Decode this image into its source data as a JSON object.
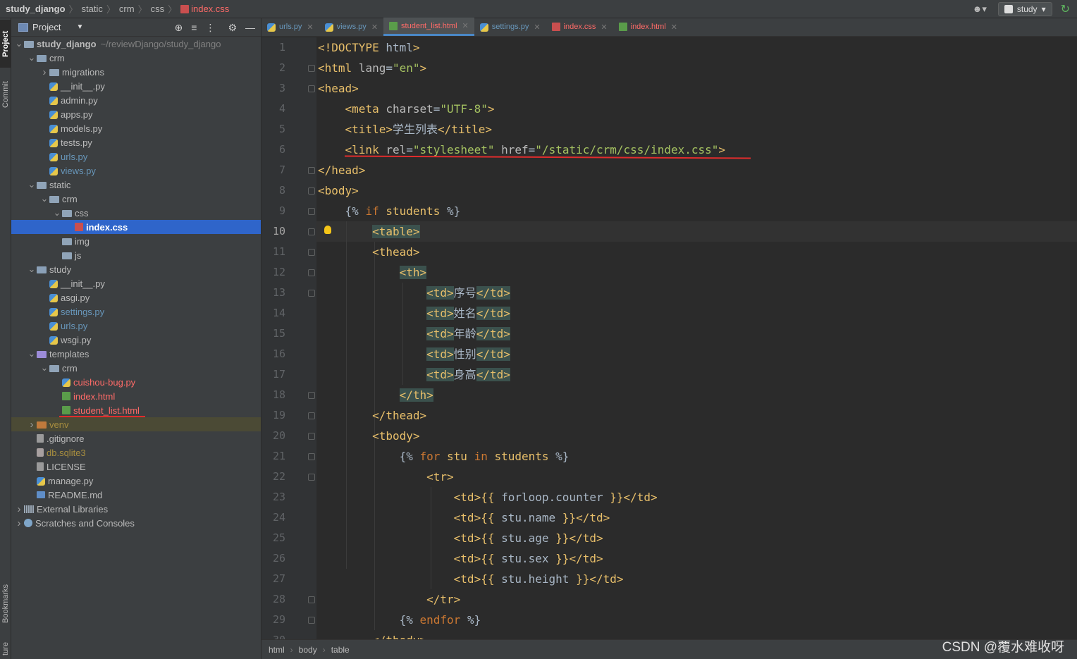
{
  "breadcrumb": {
    "items": [
      "study_django",
      "static",
      "crm",
      "css",
      "index.css"
    ]
  },
  "run_config": {
    "label": "study"
  },
  "left_strip": {
    "project": "Project",
    "commit": "Commit",
    "bookmarks": "Bookmarks",
    "structure": "ture"
  },
  "project_panel": {
    "title": "Project",
    "tree": [
      {
        "label": "study_django",
        "hint": "~/reviewDjango/study_django",
        "depth": 0,
        "type": "folder",
        "open": true,
        "bold": true
      },
      {
        "label": "crm",
        "depth": 1,
        "type": "folder-mod",
        "open": true
      },
      {
        "label": "migrations",
        "depth": 2,
        "type": "folder",
        "collapsed": true
      },
      {
        "label": "__init__.py",
        "depth": 2,
        "type": "py"
      },
      {
        "label": "admin.py",
        "depth": 2,
        "type": "py"
      },
      {
        "label": "apps.py",
        "depth": 2,
        "type": "py"
      },
      {
        "label": "models.py",
        "depth": 2,
        "type": "py"
      },
      {
        "label": "tests.py",
        "depth": 2,
        "type": "py"
      },
      {
        "label": "urls.py",
        "depth": 2,
        "type": "py",
        "color": "blue"
      },
      {
        "label": "views.py",
        "depth": 2,
        "type": "py",
        "color": "blue"
      },
      {
        "label": "static",
        "depth": 1,
        "type": "folder",
        "open": true
      },
      {
        "label": "crm",
        "depth": 2,
        "type": "folder",
        "open": true
      },
      {
        "label": "css",
        "depth": 3,
        "type": "folder",
        "open": true
      },
      {
        "label": "index.css",
        "depth": 4,
        "type": "css",
        "selected": true
      },
      {
        "label": "img",
        "depth": 3,
        "type": "folder"
      },
      {
        "label": "js",
        "depth": 3,
        "type": "folder"
      },
      {
        "label": "study",
        "depth": 1,
        "type": "folder-mod",
        "open": true
      },
      {
        "label": "__init__.py",
        "depth": 2,
        "type": "py"
      },
      {
        "label": "asgi.py",
        "depth": 2,
        "type": "py"
      },
      {
        "label": "settings.py",
        "depth": 2,
        "type": "py",
        "color": "blue"
      },
      {
        "label": "urls.py",
        "depth": 2,
        "type": "py",
        "color": "blue"
      },
      {
        "label": "wsgi.py",
        "depth": 2,
        "type": "py"
      },
      {
        "label": "templates",
        "depth": 1,
        "type": "folder-tpl",
        "open": true
      },
      {
        "label": "crm",
        "depth": 2,
        "type": "folder",
        "open": true
      },
      {
        "label": "cuishou-bug.py",
        "depth": 3,
        "type": "py",
        "color": "red"
      },
      {
        "label": "index.html",
        "depth": 3,
        "type": "html",
        "color": "red"
      },
      {
        "label": "student_list.html",
        "depth": 3,
        "type": "html",
        "color": "red",
        "underline": true
      },
      {
        "label": "venv",
        "depth": 1,
        "type": "folder-ex",
        "collapsed": true,
        "color": "olive",
        "venv": true
      },
      {
        "label": ".gitignore",
        "depth": 1,
        "type": "txt"
      },
      {
        "label": "db.sqlite3",
        "depth": 1,
        "type": "db",
        "color": "olive"
      },
      {
        "label": "LICENSE",
        "depth": 1,
        "type": "txt"
      },
      {
        "label": "manage.py",
        "depth": 1,
        "type": "py"
      },
      {
        "label": "README.md",
        "depth": 1,
        "type": "md"
      },
      {
        "label": "External Libraries",
        "depth": 0,
        "type": "lib",
        "collapsed": true
      },
      {
        "label": "Scratches and Consoles",
        "depth": 0,
        "type": "scratch",
        "collapsed": true
      }
    ]
  },
  "tabs": [
    {
      "label": "urls.py",
      "type": "py"
    },
    {
      "label": "views.py",
      "type": "py"
    },
    {
      "label": "student_list.html",
      "type": "html",
      "active": true
    },
    {
      "label": "settings.py",
      "type": "py"
    },
    {
      "label": "index.css",
      "type": "css"
    },
    {
      "label": "index.html",
      "type": "html"
    }
  ],
  "editor": {
    "current_line": 10,
    "lines": [
      "<!DOCTYPE html>",
      "<html lang=\"en\">",
      "<head>",
      "    <meta charset=\"UTF-8\">",
      "    <title>学生列表</title>",
      "    <link rel=\"stylesheet\" href=\"/static/crm/css/index.css\">",
      "</head>",
      "<body>",
      "    {% if students %}",
      "        <table>",
      "        <thead>",
      "            <th>",
      "                <td>序号</td>",
      "                <td>姓名</td>",
      "                <td>年龄</td>",
      "                <td>性别</td>",
      "                <td>身高</td>",
      "            </th>",
      "        </thead>",
      "        <tbody>",
      "            {% for stu in students %}",
      "                <tr>",
      "                    <td>{{ forloop.counter }}</td>",
      "                    <td>{{ stu.name }}</td>",
      "                    <td>{{ stu.age }}</td>",
      "                    <td>{{ stu.sex }}</td>",
      "                    <td>{{ stu.height }}</td>",
      "                </tr>",
      "            {% endfor %}",
      "        </tbody>"
    ]
  },
  "status_breadcrumb": [
    "html",
    "body",
    "table"
  ],
  "watermark": "CSDN @覆水难收呀"
}
